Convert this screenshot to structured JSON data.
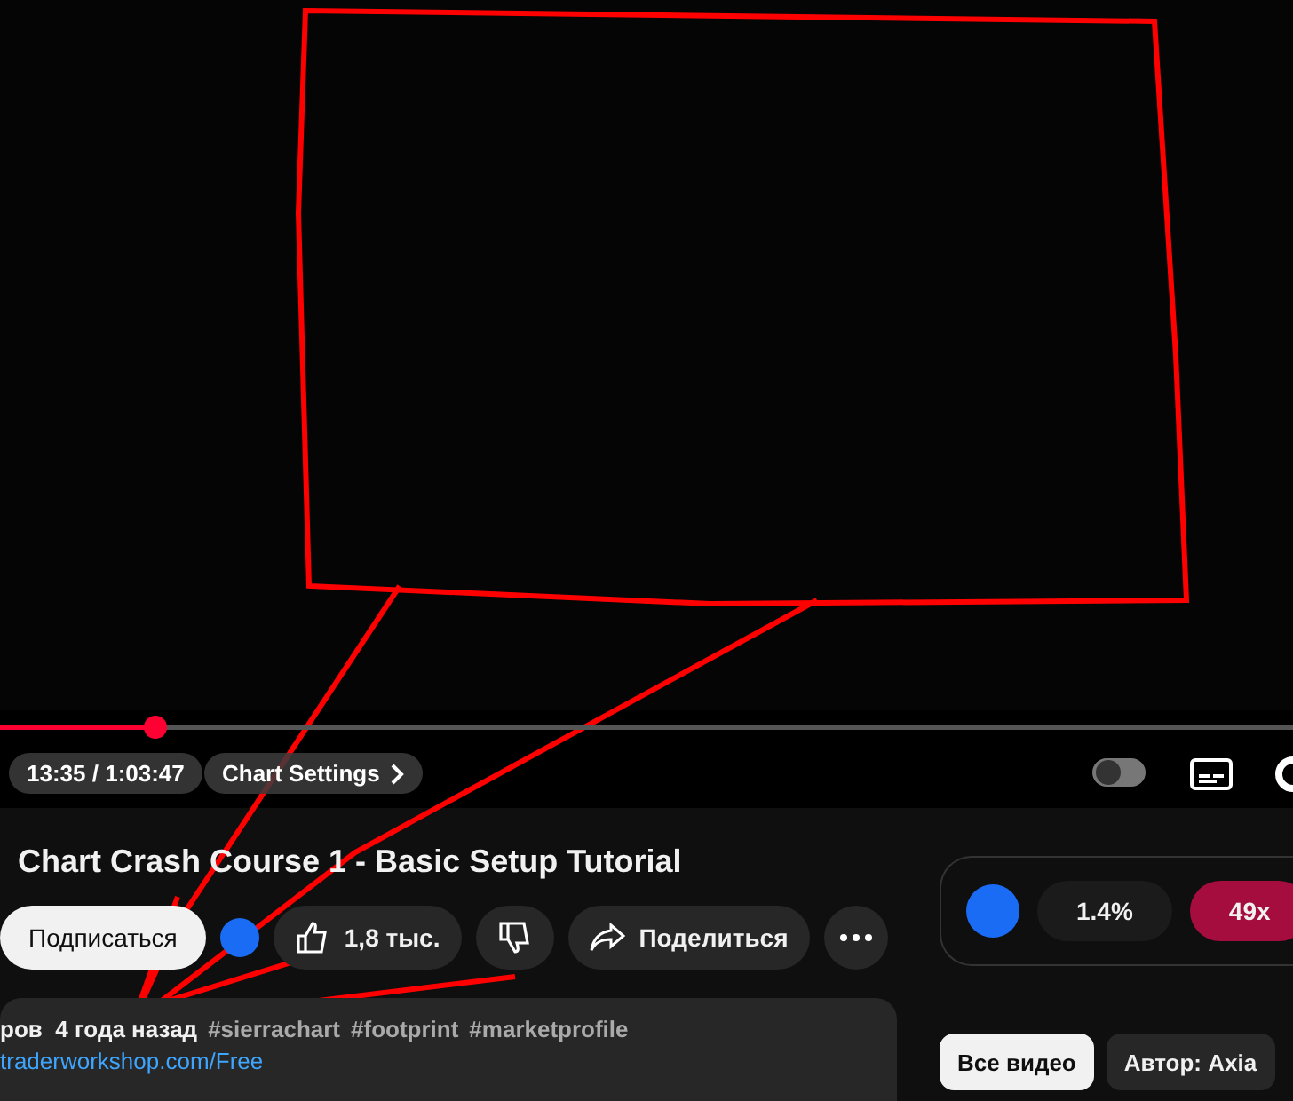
{
  "video": {
    "progress": {
      "level": 0.12
    },
    "time": "13:35 / 1:03:47",
    "chapter": "Chart Settings",
    "autoplay": {
      "on": false
    }
  },
  "title": "Chart Crash Course 1 - Basic Setup Tutorial",
  "actions": {
    "subscribe": "Подписаться",
    "likes": "1,8 тыс.",
    "share": "Поделиться"
  },
  "description": {
    "meta": "ров  4 года назад",
    "hashtags": [
      "#sierrachart",
      "#footprint",
      "#marketprofile"
    ],
    "link": "traderworkshop.com/Free"
  },
  "sidebar": {
    "stats": [
      {
        "label": "1.4%",
        "kind": "plain"
      },
      {
        "label": "49x",
        "kind": "accent"
      }
    ],
    "chips": [
      {
        "label": "Все видео",
        "selected": true
      },
      {
        "label": "Автор: Axia",
        "selected": false
      }
    ]
  }
}
